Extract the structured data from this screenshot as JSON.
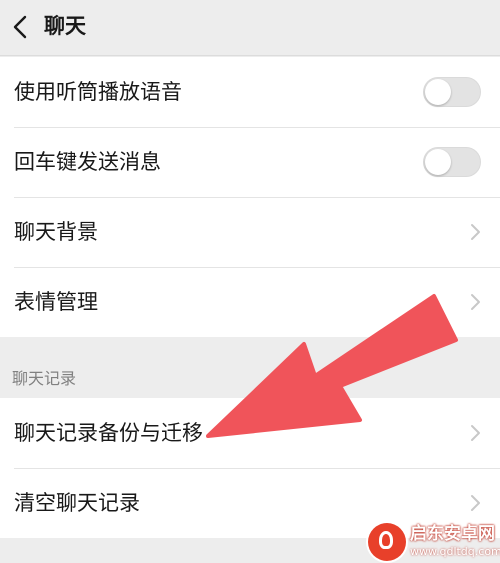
{
  "header": {
    "title": "聊天"
  },
  "settings_group_1": {
    "items": [
      {
        "label": "使用听筒播放语音",
        "control": "toggle",
        "enabled": false
      },
      {
        "label": "回车键发送消息",
        "control": "toggle",
        "enabled": false
      },
      {
        "label": "聊天背景",
        "control": "chevron"
      },
      {
        "label": "表情管理",
        "control": "chevron"
      }
    ]
  },
  "chat_history_section": {
    "title": "聊天记录",
    "items": [
      {
        "label": "聊天记录备份与迁移",
        "control": "chevron"
      },
      {
        "label": "清空聊天记录",
        "control": "chevron"
      }
    ]
  },
  "annotation": {
    "arrow_color": "#f0545a"
  },
  "watermark": {
    "title": "启东安卓网",
    "url": "www.qdltdq.com"
  },
  "colors": {
    "background": "#ededed",
    "card": "#ffffff",
    "divider": "#e4e4e4",
    "toggle_off": "#e3e3e3",
    "secondary_text": "#808080"
  }
}
